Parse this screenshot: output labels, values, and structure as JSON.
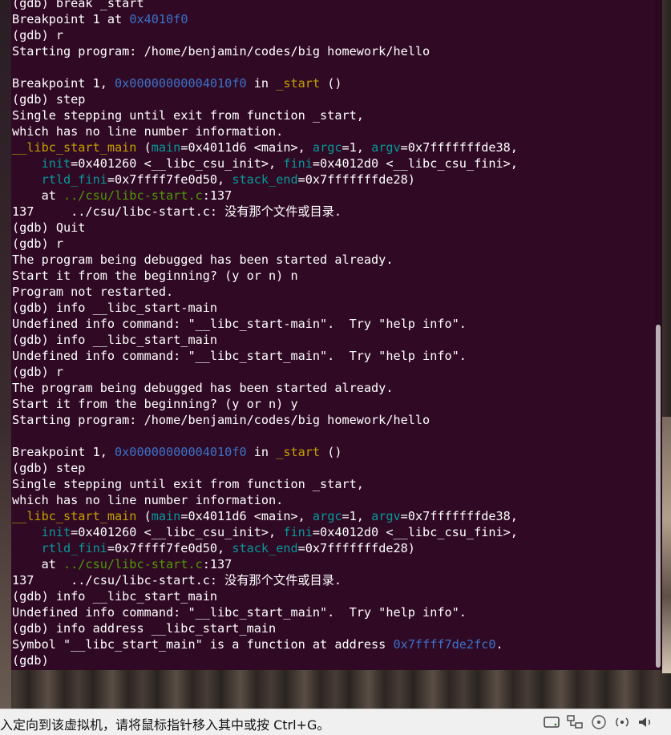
{
  "terminal": {
    "lines": [
      [
        {
          "t": "(gdb) break _start"
        }
      ],
      [
        {
          "t": "Breakpoint 1 at "
        },
        {
          "t": "0x4010f0",
          "c": "blue"
        }
      ],
      [
        {
          "t": "(gdb) r"
        }
      ],
      [
        {
          "t": "Starting program: /home/benjamin/codes/big homework/hello"
        }
      ],
      [
        {
          "t": ""
        }
      ],
      [
        {
          "t": "Breakpoint 1, "
        },
        {
          "t": "0x00000000004010f0",
          "c": "blue"
        },
        {
          "t": " in "
        },
        {
          "t": "_start",
          "c": "yellow"
        },
        {
          "t": " ()"
        }
      ],
      [
        {
          "t": "(gdb) step"
        }
      ],
      [
        {
          "t": "Single stepping until exit from function _start,"
        }
      ],
      [
        {
          "t": "which has no line number information."
        }
      ],
      [
        {
          "t": "__libc_start_main",
          "c": "yellow"
        },
        {
          "t": " ("
        },
        {
          "t": "main",
          "c": "cyan"
        },
        {
          "t": "=0x4011d6 <main>, "
        },
        {
          "t": "argc",
          "c": "cyan"
        },
        {
          "t": "=1, "
        },
        {
          "t": "argv",
          "c": "cyan"
        },
        {
          "t": "=0x7fffffffde38,"
        }
      ],
      [
        {
          "t": "    "
        },
        {
          "t": "init",
          "c": "cyan"
        },
        {
          "t": "=0x401260 <__libc_csu_init>, "
        },
        {
          "t": "fini",
          "c": "cyan"
        },
        {
          "t": "=0x4012d0 <__libc_csu_fini>,"
        }
      ],
      [
        {
          "t": "    "
        },
        {
          "t": "rtld_fini",
          "c": "cyan"
        },
        {
          "t": "=0x7ffff7fe0d50, "
        },
        {
          "t": "stack_end",
          "c": "cyan"
        },
        {
          "t": "=0x7fffffffde28)"
        }
      ],
      [
        {
          "t": "    at "
        },
        {
          "t": "../csu/libc-start.c",
          "c": "green"
        },
        {
          "t": ":137"
        }
      ],
      [
        {
          "t": "137     ../csu/libc-start.c: 没有那个文件或目录."
        }
      ],
      [
        {
          "t": "(gdb) Quit"
        }
      ],
      [
        {
          "t": "(gdb) r"
        }
      ],
      [
        {
          "t": "The program being debugged has been started already."
        }
      ],
      [
        {
          "t": "Start it from the beginning? (y or n) n"
        }
      ],
      [
        {
          "t": "Program not restarted."
        }
      ],
      [
        {
          "t": "(gdb) info __libc_start-main"
        }
      ],
      [
        {
          "t": "Undefined info command: \"__libc_start-main\".  Try \"help info\"."
        }
      ],
      [
        {
          "t": "(gdb) info __libc_start_main"
        }
      ],
      [
        {
          "t": "Undefined info command: \"__libc_start_main\".  Try \"help info\"."
        }
      ],
      [
        {
          "t": "(gdb) r"
        }
      ],
      [
        {
          "t": "The program being debugged has been started already."
        }
      ],
      [
        {
          "t": "Start it from the beginning? (y or n) y"
        }
      ],
      [
        {
          "t": "Starting program: /home/benjamin/codes/big homework/hello"
        }
      ],
      [
        {
          "t": ""
        }
      ],
      [
        {
          "t": "Breakpoint 1, "
        },
        {
          "t": "0x00000000004010f0",
          "c": "blue"
        },
        {
          "t": " in "
        },
        {
          "t": "_start",
          "c": "yellow"
        },
        {
          "t": " ()"
        }
      ],
      [
        {
          "t": "(gdb) step"
        }
      ],
      [
        {
          "t": "Single stepping until exit from function _start,"
        }
      ],
      [
        {
          "t": "which has no line number information."
        }
      ],
      [
        {
          "t": "__libc_start_main",
          "c": "yellow"
        },
        {
          "t": " ("
        },
        {
          "t": "main",
          "c": "cyan"
        },
        {
          "t": "=0x4011d6 <main>, "
        },
        {
          "t": "argc",
          "c": "cyan"
        },
        {
          "t": "=1, "
        },
        {
          "t": "argv",
          "c": "cyan"
        },
        {
          "t": "=0x7fffffffde38,"
        }
      ],
      [
        {
          "t": "    "
        },
        {
          "t": "init",
          "c": "cyan"
        },
        {
          "t": "=0x401260 <__libc_csu_init>, "
        },
        {
          "t": "fini",
          "c": "cyan"
        },
        {
          "t": "=0x4012d0 <__libc_csu_fini>,"
        }
      ],
      [
        {
          "t": "    "
        },
        {
          "t": "rtld_fini",
          "c": "cyan"
        },
        {
          "t": "=0x7ffff7fe0d50, "
        },
        {
          "t": "stack_end",
          "c": "cyan"
        },
        {
          "t": "=0x7fffffffde28)"
        }
      ],
      [
        {
          "t": "    at "
        },
        {
          "t": "../csu/libc-start.c",
          "c": "green"
        },
        {
          "t": ":137"
        }
      ],
      [
        {
          "t": "137     ../csu/libc-start.c: 没有那个文件或目录."
        }
      ],
      [
        {
          "t": "(gdb) info __libc_start_main"
        }
      ],
      [
        {
          "t": "Undefined info command: \"__libc_start_main\".  Try \"help info\"."
        }
      ],
      [
        {
          "t": "(gdb) info address __libc_start_main"
        }
      ],
      [
        {
          "t": "Symbol \"__libc_start_main\" is a function at address "
        },
        {
          "t": "0x7ffff7de2fc0",
          "c": "blue"
        },
        {
          "t": "."
        }
      ],
      [
        {
          "t": "(gdb) "
        }
      ]
    ]
  },
  "status_bar": {
    "message": "入定向到该虚拟机，请将鼠标指针移入其中或按 Ctrl+G。",
    "icons": [
      "hard-disk-icon",
      "network-icon",
      "optical-drive-icon",
      "sound-icon",
      "volume-icon"
    ]
  },
  "colors": {
    "terminal_bg": "#300a24",
    "text": "#ffffff",
    "address_blue": "#3a72c9",
    "function_yellow": "#c4a000",
    "param_cyan": "#06989a",
    "path_green": "#4e9a06"
  }
}
